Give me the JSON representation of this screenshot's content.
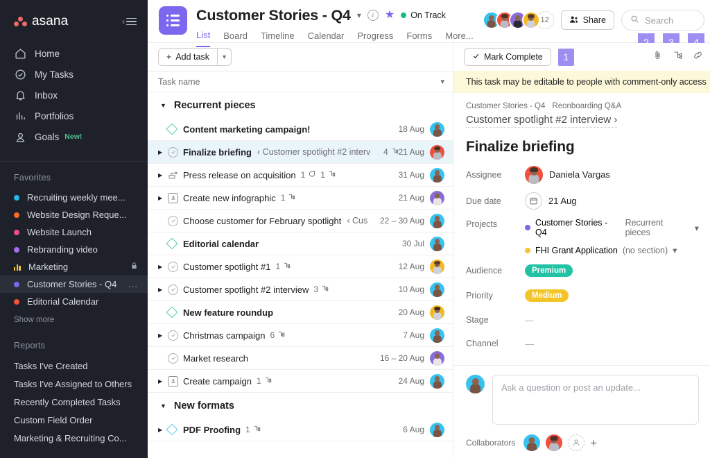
{
  "sidebar": {
    "brand": "asana",
    "collapse_icon": "collapse-sidebar-icon",
    "nav": [
      {
        "label": "Home",
        "icon": "home-icon"
      },
      {
        "label": "My Tasks",
        "icon": "check-circle-icon"
      },
      {
        "label": "Inbox",
        "icon": "bell-icon"
      },
      {
        "label": "Portfolios",
        "icon": "bar-chart-icon"
      },
      {
        "label": "Goals",
        "icon": "goal-icon",
        "badge": "New!"
      }
    ],
    "favorites_title": "Favorites",
    "favorites": [
      {
        "label": "Recruiting weekly mee...",
        "color": "#29b6e8",
        "type": "dot"
      },
      {
        "label": "Website Design Reque...",
        "color": "#fa6d2a",
        "type": "dot"
      },
      {
        "label": "Website Launch",
        "color": "#ed4c8e",
        "type": "dot"
      },
      {
        "label": "Rebranding video",
        "color": "#a66bf0",
        "type": "dot"
      },
      {
        "label": "Marketing",
        "color": "#f5c33b",
        "type": "bars",
        "trailing": "lock-icon"
      },
      {
        "label": "Customer Stories - Q4",
        "color": "#7b68ee",
        "type": "dot",
        "active": true,
        "trailing": "..."
      },
      {
        "label": "Editorial Calendar",
        "color": "#f0503c",
        "type": "dot"
      }
    ],
    "show_more": "Show more",
    "reports_title": "Reports",
    "reports": [
      "Tasks I've Created",
      "Tasks I've Assigned to Others",
      "Recently Completed Tasks",
      "Custom Field Order",
      "Marketing & Recruiting Co..."
    ]
  },
  "header": {
    "project_title": "Customer Stories - Q4",
    "project_icon": "list-project-icon",
    "chevron_icon": "chevron-down-icon",
    "info_icon": "info-icon",
    "star_icon": "star-icon",
    "status_label": "On Track",
    "status_color": "#14bb8a",
    "tabs": [
      {
        "label": "List",
        "active": true
      },
      {
        "label": "Board",
        "active": false
      },
      {
        "label": "Timeline",
        "active": false
      },
      {
        "label": "Calendar",
        "active": false
      },
      {
        "label": "Progress",
        "active": false
      },
      {
        "label": "Forms",
        "active": false
      },
      {
        "label": "More...",
        "active": false
      }
    ],
    "member_overflow_count": "12",
    "share_label": "Share",
    "share_icon": "people-icon",
    "search_placeholder": "Search",
    "search_icon": "search-icon"
  },
  "list": {
    "add_task_label": "Add task",
    "add_task_caret": "chevron-down-icon",
    "column_header": "Task name",
    "column_caret": "chevron-down-icon",
    "sections": [
      {
        "name": "Recurrent pieces",
        "tasks": [
          {
            "name": "Content  marketing campaign!",
            "bold": true,
            "status": "milestone",
            "date": "18 Aug",
            "expand": false,
            "avatar": "#37c3ef"
          },
          {
            "name": "Finalize briefing",
            "bold": true,
            "status": "task",
            "parent": "‹ Customer spotlight #2 interv",
            "subtasks": "4",
            "date": "21 Aug",
            "expand": true,
            "selected": true,
            "avatar": "#f0503c"
          },
          {
            "name": "Press release on acquisition",
            "bold": false,
            "status": "approval-flow",
            "comments": "1",
            "subtasks": "1",
            "date": "31 Aug",
            "expand": true,
            "avatar": "#37c3ef"
          },
          {
            "name": "Create new infographic",
            "bold": false,
            "status": "approval",
            "subtasks": "1",
            "date": "21 Aug",
            "expand": true,
            "avatar": "#8a6ddb"
          },
          {
            "name": "Choose customer for February spotlight",
            "bold": false,
            "status": "task",
            "parent": "‹ Cus",
            "date": "22 – 30 Aug",
            "expand": false,
            "avatar": "#37c3ef"
          },
          {
            "name": "Editorial calendar",
            "bold": true,
            "status": "milestone",
            "date": "30 Jul",
            "expand": false,
            "avatar": "#37c3ef"
          },
          {
            "name": "Customer spotlight #1",
            "bold": false,
            "status": "task",
            "subtasks": "1",
            "date": "12 Aug",
            "expand": true,
            "avatar": "#f3b922"
          },
          {
            "name": "Customer spotlight #2 interview",
            "bold": false,
            "status": "task",
            "subtasks": "3",
            "date": "10 Aug",
            "expand": true,
            "avatar": "#37c3ef"
          },
          {
            "name": "New feature roundup",
            "bold": true,
            "status": "milestone",
            "date": "20 Aug",
            "expand": false,
            "avatar": "#f3b922"
          },
          {
            "name": "Christmas campaign",
            "bold": false,
            "status": "task",
            "subtasks": "6",
            "date": "7 Aug",
            "expand": true,
            "avatar": "#37c3ef"
          },
          {
            "name": "Market research",
            "bold": false,
            "status": "task",
            "date": "16 – 20 Aug",
            "expand": false,
            "avatar": "#8a6ddb"
          },
          {
            "name": "Create campaign",
            "bold": false,
            "status": "approval",
            "subtasks": "1",
            "date": "24 Aug",
            "expand": true,
            "avatar": "#37c3ef"
          }
        ]
      },
      {
        "name": "New formats",
        "tasks": [
          {
            "name": "PDF Proofing",
            "bold": true,
            "status": "milestone",
            "subtasks": "1",
            "date": "6 Aug",
            "expand": true,
            "avatar": "#37c3ef"
          }
        ]
      }
    ]
  },
  "detail": {
    "mark_complete_label": "Mark Complete",
    "mark_complete_icon": "check-icon",
    "badges": [
      "1",
      "2",
      "3",
      "4"
    ],
    "action_icons": [
      "paperclip-icon",
      "subtask-icon",
      "link-icon"
    ],
    "banner": "This task may be editable to people with comment-only access",
    "breadcrumbs": [
      "Customer Stories - Q4",
      "Reonboarding Q&A"
    ],
    "parent_task": "Customer spotlight #2 interview ›",
    "title": "Finalize briefing",
    "fields": {
      "assignee_label": "Assignee",
      "assignee_value": "Daniela Vargas",
      "due_date_label": "Due date",
      "due_date_value": "21 Aug",
      "due_date_icon": "calendar-icon",
      "projects_label": "Projects",
      "projects": [
        {
          "name": "Customer Stories - Q4",
          "color": "#7b68ee",
          "section": "Recurrent pieces",
          "caret": "chevron-down-icon"
        },
        {
          "name": "FHI Grant Application",
          "color": "#f5c33b",
          "section": "(no section)",
          "caret": "chevron-down-icon"
        }
      ],
      "audience_label": "Audience",
      "audience_value": "Premium",
      "audience_color": "#22c2a5",
      "priority_label": "Priority",
      "priority_value": "Medium",
      "priority_color": "#f2c528",
      "stage_label": "Stage",
      "stage_value": "—",
      "channel_label": "Channel",
      "channel_value": "—"
    },
    "comment_placeholder": "Ask a question or post an update...",
    "collaborators_label": "Collaborators",
    "add_collaborator_icon": "add-person-icon"
  }
}
